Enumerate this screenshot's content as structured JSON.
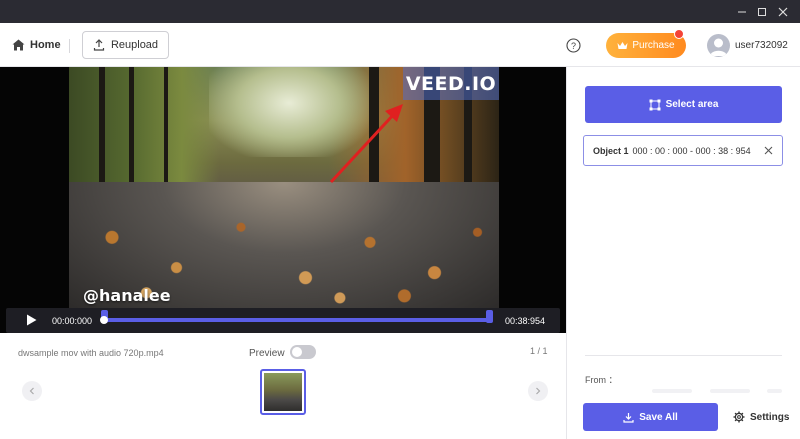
{
  "toolbar": {
    "home_label": "Home",
    "reupload_label": "Reupload",
    "purchase_label": "Purchase",
    "username": "user732092",
    "purchase_color": "#ff9a2a"
  },
  "video": {
    "watermark_text": "VEED.IO",
    "overlay_user": "@hanalee",
    "current_time": "00:00:000",
    "total_time": "00:38:954",
    "accent_color": "#5a5ee6"
  },
  "filebar": {
    "filename": "dwsample mov with audio 720p.mp4",
    "preview_label": "Preview",
    "preview_enabled": false,
    "pager": "1 / 1"
  },
  "panel": {
    "select_area_label": "Select area",
    "objects": [
      {
        "name": "Object 1",
        "range": "000 : 00 : 000 - 000 : 38 : 954"
      }
    ],
    "from_label": "From ：",
    "save_all_label": "Save All",
    "settings_label": "Settings"
  }
}
